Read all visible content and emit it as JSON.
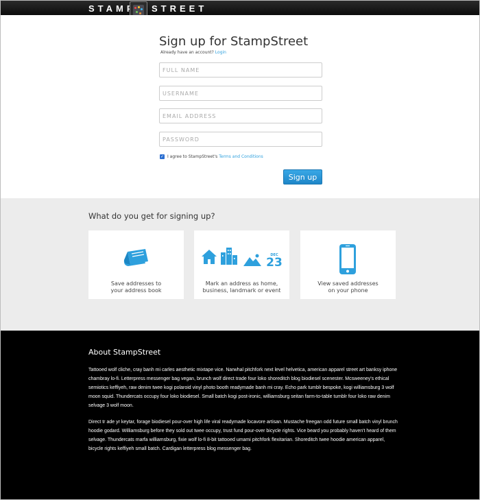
{
  "header": {
    "brand_left": "STAMP",
    "brand_right": "STREET",
    "logo_icon": "stamp-logo-icon"
  },
  "signup": {
    "title": "Sign up for StampStreet",
    "have_account_text": "Already have an account?",
    "login_link": "Login",
    "fields": {
      "full_name_placeholder": "FULL NAME",
      "username_placeholder": "USERNAME",
      "email_placeholder": "EMAIL ADDRESS",
      "password_placeholder": "PASSWORD"
    },
    "agree_text": "I agree to StampStreet's",
    "terms_link": "Terms and Conditions",
    "agree_checked": true,
    "button_label": "Sign up"
  },
  "features": {
    "title": "What do you get for signing up?",
    "cards": [
      {
        "icon": "book-icon",
        "line1": "Save addresses to",
        "line2": "your address book"
      },
      {
        "icon": "home-business-landmark-calendar-icon",
        "line1": "Mark an address as home,",
        "line2": "business, landmark or event",
        "calendar_month": "DEC",
        "calendar_day": "23"
      },
      {
        "icon": "phone-icon",
        "line1": "View saved addresses",
        "line2": "on your phone"
      }
    ]
  },
  "about": {
    "title": "About StampStreet",
    "paragraph1": "Tattooed wolf cliche, cray banh mi carles aesthetic mixtape vice. Narwhal pitchfork next level helvetica, american apparel street art banksy iphone chambray lo-fi. Letterpress messenger bag vegan, brunch wolf direct trade four loko shoreditch blog biodiesel scenester. Mcsweeney's ethical semiotics keffiyeh, raw denim twee kogi polaroid vinyl photo booth readymade banh mi cray. Echo park tumblr bespoke, kogi williamsburg 3 wolf moon squid. Thundercats occupy four loko biodiesel. Small batch kogi post-ironic, williamsburg seitan farm-to-table tumblr four loko raw denim selvage 3 wolf moon.",
    "paragraph2": "Direct tr ade yr keytar, forage biodiesel pour-over high life viral readymade locavore artisan. Mustache freegan odd future small batch vinyl brunch hoodie godard. Williamsburg before they sold out twee occupy, trust fund pour-over bicycle rights. Vice beard you probably haven't heard of them selvage. Thundercats marfa williamsburg, fixie wolf lo-fi 8-bit tattooed umami pitchfork flexitarian. Shoreditch twee hoodie american apparel, bicycle rights keffiyeh small batch. Cardigan letterpress blog messenger bag."
  },
  "colors": {
    "accent": "#2ea0dd",
    "button": "#2489cb",
    "feature_bg": "#ececec",
    "footer_bg": "#000000"
  }
}
